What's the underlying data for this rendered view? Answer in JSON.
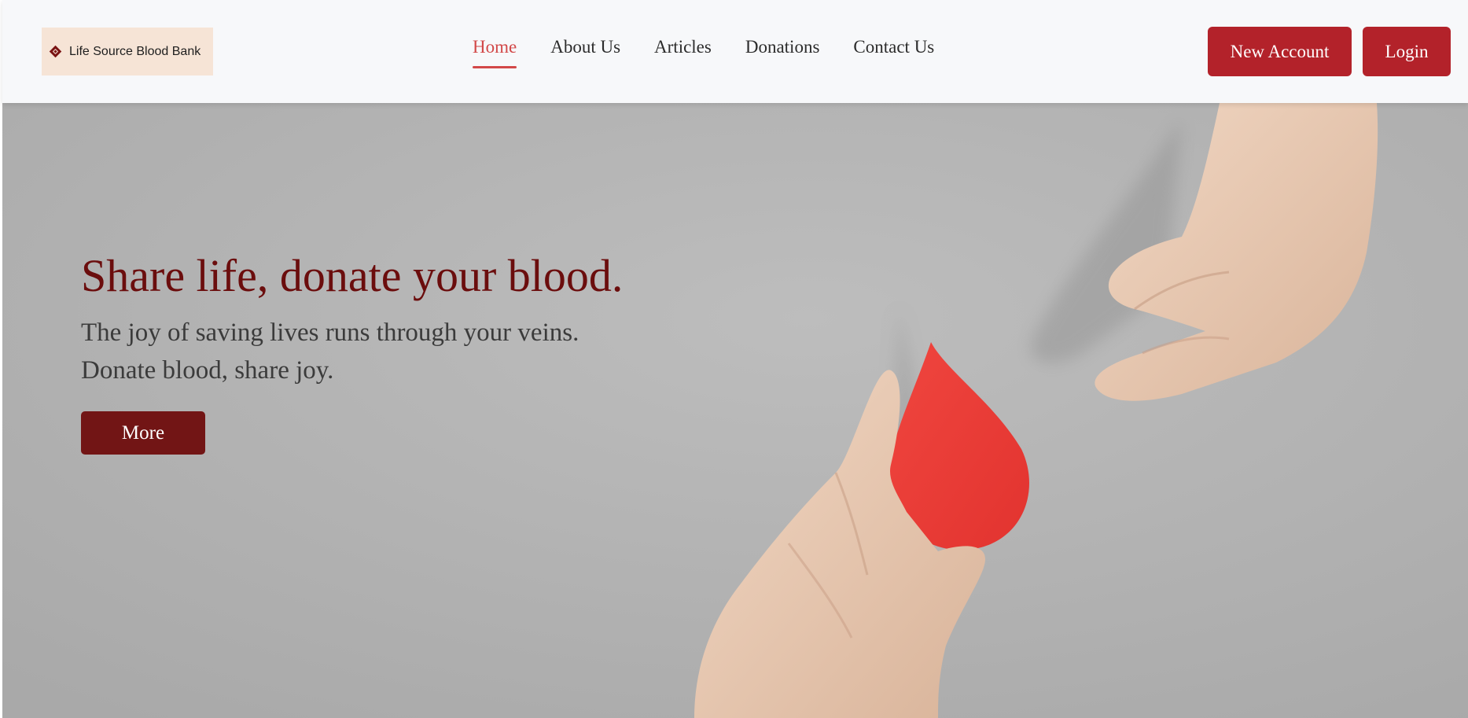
{
  "header": {
    "logo_text": "Life Source Blood Bank",
    "logo_icon": "diamond-icon",
    "nav": [
      {
        "label": "Home",
        "active": true
      },
      {
        "label": "About Us",
        "active": false
      },
      {
        "label": "Articles",
        "active": false
      },
      {
        "label": "Donations",
        "active": false
      },
      {
        "label": "Contact Us",
        "active": false
      }
    ],
    "new_account_label": "New Account",
    "login_label": "Login"
  },
  "hero": {
    "title": "Share life, donate your blood.",
    "subtitle_line1": "The joy of saving lives runs through your veins.",
    "subtitle_line2": "Donate blood, share joy.",
    "more_label": "More"
  },
  "colors": {
    "brand_red": "#b3222a",
    "dark_red": "#721515",
    "title_red": "#6b0d0d",
    "active_nav": "#d24848",
    "logo_bg": "#f6e4d6"
  }
}
